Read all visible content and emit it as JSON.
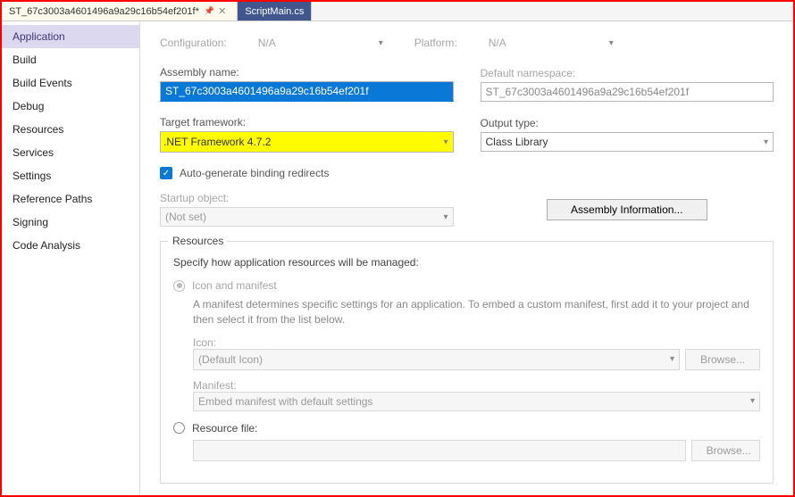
{
  "tabs": {
    "active": "ST_67c3003a4601496a9a29c16b54ef201f*",
    "secondary": "ScriptMain.cs"
  },
  "sidebar": {
    "items": [
      {
        "label": "Application",
        "active": true
      },
      {
        "label": "Build"
      },
      {
        "label": "Build Events"
      },
      {
        "label": "Debug"
      },
      {
        "label": "Resources"
      },
      {
        "label": "Services"
      },
      {
        "label": "Settings"
      },
      {
        "label": "Reference Paths"
      },
      {
        "label": "Signing"
      },
      {
        "label": "Code Analysis"
      }
    ]
  },
  "config_row": {
    "configuration_label": "Configuration:",
    "configuration_value": "N/A",
    "platform_label": "Platform:",
    "platform_value": "N/A"
  },
  "assembly": {
    "name_label": "Assembly name:",
    "name_value": "ST_67c3003a4601496a9a29c16b54ef201f",
    "namespace_label": "Default namespace:",
    "namespace_value": "ST_67c3003a4601496a9a29c16b54ef201f"
  },
  "framework": {
    "target_label": "Target framework:",
    "target_value": ".NET Framework 4.7.2",
    "output_label": "Output type:",
    "output_value": "Class Library"
  },
  "autogen_label": "Auto-generate binding redirects",
  "startup": {
    "label": "Startup object:",
    "value": "(Not set)"
  },
  "assembly_info_btn": "Assembly Information...",
  "resources": {
    "legend": "Resources",
    "intro": "Specify how application resources will be managed:",
    "icon_manifest_label": "Icon and manifest",
    "icon_manifest_desc": "A manifest determines specific settings for an application. To embed a custom manifest, first add it to your project and then select it from the list below.",
    "icon_label": "Icon:",
    "icon_value": "(Default Icon)",
    "manifest_label": "Manifest:",
    "manifest_value": "Embed manifest with default settings",
    "resource_file_label": "Resource file:",
    "browse": "Browse..."
  }
}
